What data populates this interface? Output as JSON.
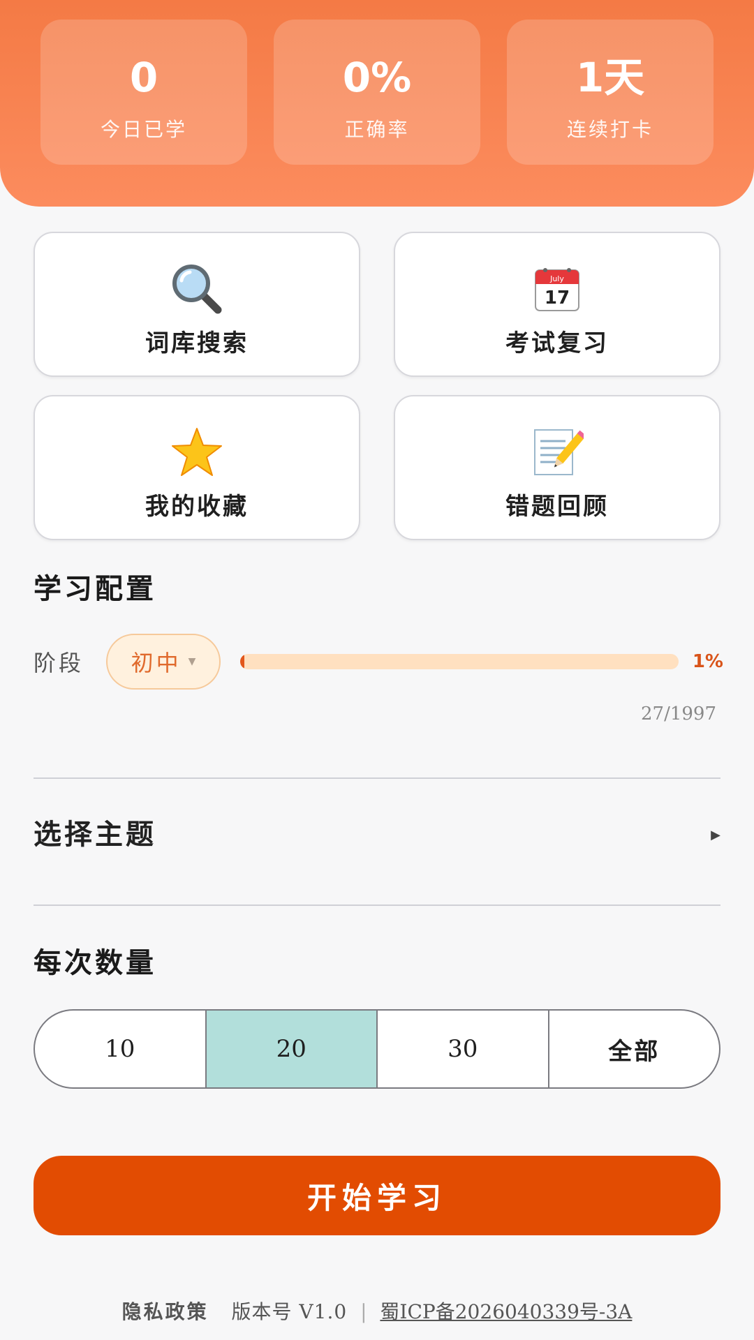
{
  "stats": [
    {
      "value": "0",
      "label": "今日已学"
    },
    {
      "value": "0%",
      "label": "正确率"
    },
    {
      "value": "1天",
      "label": "连续打卡"
    }
  ],
  "features": [
    {
      "label": "词库搜索",
      "icon": "magnifier-icon"
    },
    {
      "label": "考试复习",
      "icon": "calendar-icon",
      "icon_month": "July",
      "icon_day": "17"
    },
    {
      "label": "我的收藏",
      "icon": "star-icon"
    },
    {
      "label": "错题回顾",
      "icon": "memo-icon"
    }
  ],
  "config": {
    "title": "学习配置",
    "stage_label": "阶段",
    "stage_value": "初中",
    "progress_percent": 1,
    "progress_text": "1%",
    "progress_count": "27/1997"
  },
  "topic": {
    "label": "选择主题"
  },
  "quantity": {
    "title": "每次数量",
    "options": [
      "10",
      "20",
      "30",
      "全部"
    ],
    "selected": "20"
  },
  "start_button": "开始学习",
  "footer": {
    "privacy": "隐私政策",
    "version": "版本号 V1.0",
    "separator": "|",
    "icp": "蜀ICP备2026040339号-3A"
  },
  "colors": {
    "header_gradient": [
      "#f47a45",
      "#fc8c5e"
    ],
    "accent": "#e24c02",
    "selected_option": "#b2dfdb"
  }
}
